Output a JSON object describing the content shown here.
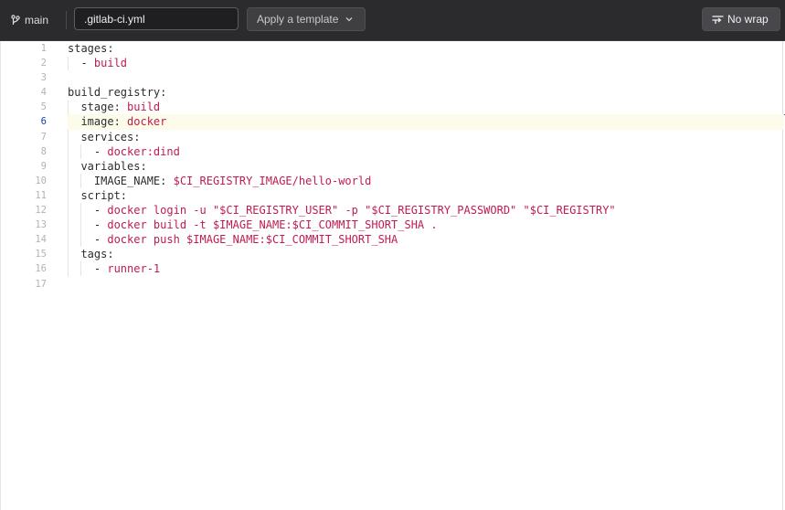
{
  "topbar": {
    "branch_label": "main",
    "branch_icon": "git-branch-icon",
    "filename_value": ".gitlab-ci.yml",
    "template_label": "Apply a template",
    "wrap_label": "No wrap"
  },
  "colors": {
    "topbar_bg": "#2b2b2d",
    "yaml_value": "#c01c4e",
    "active_line_number": "#1f3ea8",
    "active_line_bg": "#fdfbea"
  },
  "editor": {
    "active_line": 6,
    "line_numbers": [
      "1",
      "2",
      "3",
      "4",
      "5",
      "6",
      "7",
      "8",
      "9",
      "10",
      "11",
      "12",
      "13",
      "14",
      "15",
      "16",
      "17"
    ],
    "lines": [
      {
        "key": "stages:",
        "value": ""
      },
      {
        "key": "  - ",
        "value": "build"
      },
      {
        "key": "",
        "value": ""
      },
      {
        "key": "build_registry:",
        "value": ""
      },
      {
        "key": "  stage: ",
        "value": "build"
      },
      {
        "key": "  image: ",
        "value": "docker"
      },
      {
        "key": "  services:",
        "value": ""
      },
      {
        "key": "    - ",
        "value": "docker:dind"
      },
      {
        "key": "  variables:",
        "value": ""
      },
      {
        "key": "    IMAGE_NAME: ",
        "value": "$CI_REGISTRY_IMAGE/hello-world"
      },
      {
        "key": "  script:",
        "value": ""
      },
      {
        "key": "    - ",
        "value": "docker login -u \"$CI_REGISTRY_USER\" -p \"$CI_REGISTRY_PASSWORD\" \"$CI_REGISTRY\""
      },
      {
        "key": "    - ",
        "value": "docker build -t $IMAGE_NAME:$CI_COMMIT_SHORT_SHA ."
      },
      {
        "key": "    - ",
        "value": "docker push $IMAGE_NAME:$CI_COMMIT_SHORT_SHA"
      },
      {
        "key": "  tags:",
        "value": ""
      },
      {
        "key": "    - ",
        "value": "runner-1"
      },
      {
        "key": "",
        "value": ""
      }
    ]
  }
}
